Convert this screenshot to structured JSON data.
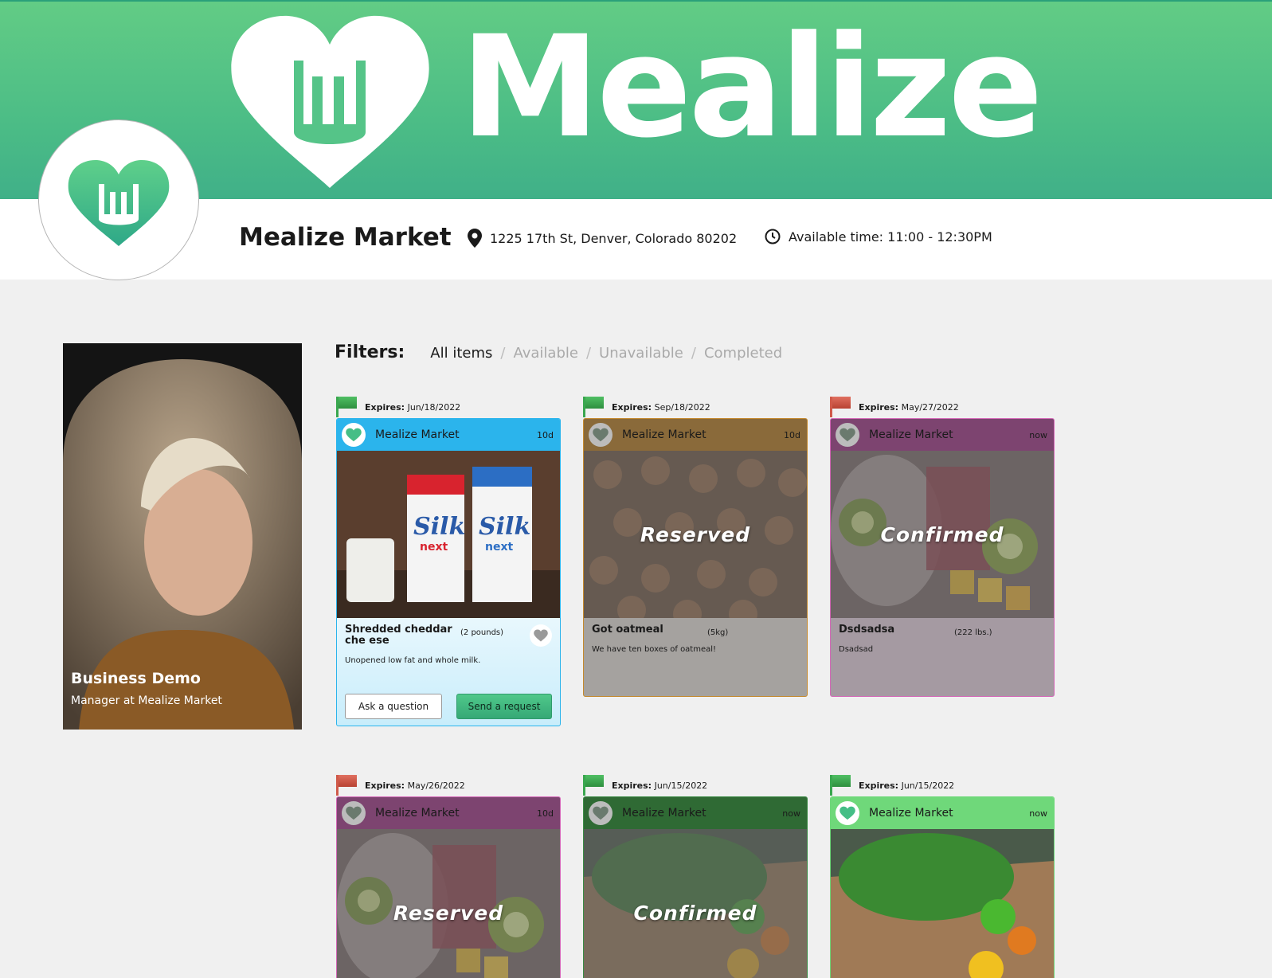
{
  "brand": {
    "wordmark": "Mealize",
    "accent": "#4cbd86"
  },
  "store": {
    "name": "Mealize Market",
    "address": "1225 17th St, Denver, Colorado 80202",
    "available_time": "Available time: 11:00 - 12:30PM"
  },
  "profile": {
    "name": "Business Demo",
    "role": "Manager at Mealize Market"
  },
  "filters": {
    "label": "Filters:",
    "options": [
      "All items",
      "Available",
      "Unavailable",
      "Completed"
    ],
    "separator": "/"
  },
  "common": {
    "expires_label": "Expires:",
    "store_name": "Mealize Market"
  },
  "items": [
    {
      "expires": "Jun/18/2022",
      "flag_color": "#3aa74f",
      "age": "10d",
      "color": "#2bb4ec",
      "title": "Shredded cheddar che ese",
      "qty": "(2 pounds)",
      "desc": "Unopened low fat and whole milk.",
      "status": "",
      "image": "milk-cartons",
      "ask_label": "Ask a question",
      "send_label": "Send a request"
    },
    {
      "expires": "Sep/18/2022",
      "flag_color": "#3aa74f",
      "age": "10d",
      "color": "#8a6a3a",
      "title": "Got oatmeal",
      "qty": "(5kg)",
      "desc": "We have ten boxes of oatmeal!",
      "status": "Reserved",
      "image": "gingerbread-cookies"
    },
    {
      "expires": "May/27/2022",
      "flag_color": "#d05a4a",
      "age": "now",
      "color": "#7d4470",
      "title": "Dsdsadsa",
      "qty": "(222 lbs.)",
      "desc": "Dsadsad",
      "status": "Confirmed",
      "image": "fruit-cups"
    },
    {
      "expires": "May/26/2022",
      "flag_color": "#d05a4a",
      "age": "10d",
      "color": "#7d4470",
      "status": "Reserved",
      "image": "fruit-cups"
    },
    {
      "expires": "Jun/15/2022",
      "flag_color": "#3aa74f",
      "age": "now",
      "color": "#2f6a34",
      "status": "Confirmed",
      "image": "vegetable-box"
    },
    {
      "expires": "Jun/15/2022",
      "flag_color": "#3aa74f",
      "age": "now",
      "color": "#6fd87a",
      "status": "",
      "image": "vegetable-box"
    }
  ]
}
